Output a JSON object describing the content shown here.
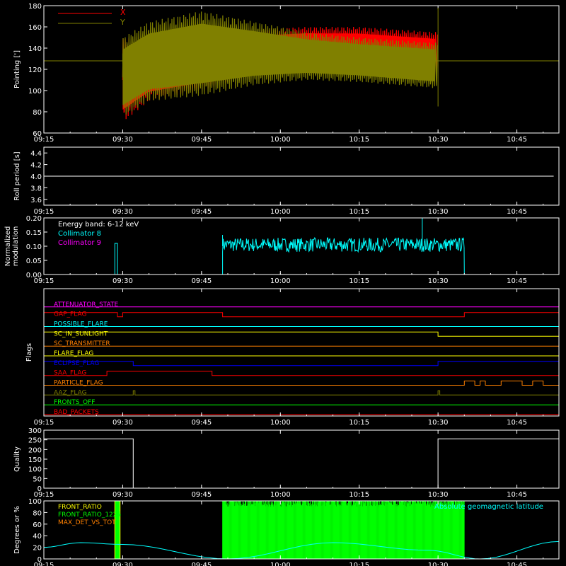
{
  "time_ticks": [
    "09:15",
    "09:30",
    "09:45",
    "10:00",
    "10:15",
    "10:30",
    "10:45"
  ],
  "colors": {
    "background": "#000000",
    "axes": "#ffffff",
    "x": "#ff0000",
    "y": "#808000",
    "cyan": "#00ffff",
    "magenta": "#ff00ff",
    "orange": "#ff8000",
    "yellow": "#ffff00",
    "blue": "#0000ff",
    "green": "#00ff00",
    "olive": "#808000",
    "red": "#ff0000"
  },
  "chart_data": [
    {
      "type": "line",
      "ylabel": "Pointing [']",
      "ylim": [
        60,
        180
      ],
      "yticks": [
        60,
        80,
        100,
        120,
        140,
        160,
        180
      ],
      "xlim": [
        "09:15",
        "10:53"
      ],
      "series": [
        {
          "name": "X",
          "color": "#ff0000",
          "envelope": [
            [
              "09:30",
              70,
              150
            ],
            [
              "09:35",
              90,
              150
            ],
            [
              "09:45",
              100,
              150
            ],
            [
              "09:55",
              115,
              158
            ],
            [
              "10:05",
              120,
              160
            ],
            [
              "10:15",
              118,
              160
            ],
            [
              "10:30",
              112,
              155
            ]
          ]
        },
        {
          "name": "Y",
          "color": "#808000",
          "envelope": [
            [
              "09:30",
              75,
              150
            ],
            [
              "09:35",
              90,
              165
            ],
            [
              "09:45",
              95,
              175
            ],
            [
              "09:55",
              105,
              165
            ],
            [
              "10:05",
              110,
              155
            ],
            [
              "10:15",
              108,
              150
            ],
            [
              "10:30",
              102,
              145
            ]
          ]
        }
      ],
      "reference_line": 128
    },
    {
      "type": "line",
      "ylabel": "Roll period [s]",
      "ylim": [
        3.5,
        4.5
      ],
      "yticks": [
        "3.6",
        "3.8",
        "4.0",
        "4.2",
        "4.4"
      ],
      "series": [
        {
          "values": [
            [
              "09:15",
              4.0
            ],
            [
              "10:52",
              4.0
            ]
          ]
        }
      ]
    },
    {
      "type": "line",
      "ylabel": "Normalized\nmodulation",
      "ylim": [
        0,
        0.2
      ],
      "yticks": [
        "0.00",
        "0.05",
        "0.10",
        "0.15",
        "0.20"
      ],
      "annotation": "Energy band: 6-12 keV",
      "series": [
        {
          "name": "Collimator 8",
          "color": "#00ffff",
          "segments": [
            [
              "09:28:30",
              "09:29:00",
              0.11
            ],
            [
              "09:49",
              "10:35",
              0.11
            ]
          ],
          "noise_range": [
            0.08,
            0.13
          ],
          "spikes": [
            [
              "09:49",
              0.14
            ],
            [
              "10:27",
              0.2
            ]
          ]
        },
        {
          "name": "Collimator 9",
          "color": "#ff00ff",
          "values": [
            [
              "09:15",
              0.0
            ],
            [
              "10:53",
              0.0
            ]
          ]
        }
      ]
    },
    {
      "type": "flags",
      "ylabel": "Flags",
      "flags": [
        {
          "name": "ATTENUATOR_STATE",
          "color": "#ff00ff",
          "high": []
        },
        {
          "name": "GAP_FLAG",
          "color": "#ff0000",
          "high": [
            [
              "09:15",
              "09:29"
            ],
            [
              "09:30",
              "09:49"
            ],
            [
              "10:35",
              "10:53"
            ]
          ]
        },
        {
          "name": "POSSIBLE_FLARE",
          "color": "#00ffff",
          "high": []
        },
        {
          "name": "SC_IN_SUNLIGHT",
          "color": "#ffff00",
          "high": [
            [
              "09:15",
              "10:30"
            ]
          ]
        },
        {
          "name": "SC_TRANSMITTER",
          "color": "#ff8000",
          "high": []
        },
        {
          "name": "FLARE_FLAG",
          "color": "#ffff00",
          "high": []
        },
        {
          "name": "ECLIPSE_FLAG",
          "color": "#0000ff",
          "high": [
            [
              "09:15",
              "09:32"
            ],
            [
              "10:30",
              "10:53"
            ]
          ]
        },
        {
          "name": "SAA_FLAG",
          "color": "#ff0000",
          "high": [
            [
              "09:27",
              "09:47"
            ]
          ]
        },
        {
          "name": "PARTICLE_FLAG",
          "color": "#ff8000",
          "high": [
            [
              "10:35",
              "10:37"
            ],
            [
              "10:38",
              "10:39"
            ],
            [
              "10:42",
              "10:46"
            ],
            [
              "10:48",
              "10:50"
            ]
          ]
        },
        {
          "name": "AAZ_FLAG",
          "color": "#808000",
          "high": [
            [
              "09:32",
              "09:32:20"
            ],
            [
              "10:30",
              "10:30:20"
            ]
          ]
        },
        {
          "name": "FRONTS_OFF",
          "color": "#00ff00",
          "high": []
        },
        {
          "name": "BAD_PACKETS",
          "color": "#ff0000",
          "high": []
        }
      ]
    },
    {
      "type": "line",
      "ylabel": "Quality",
      "ylim": [
        0,
        300
      ],
      "yticks": [
        0,
        50,
        100,
        150,
        200,
        250,
        300
      ],
      "series": [
        {
          "values": [
            [
              "09:15",
              255
            ],
            [
              "09:32",
              255
            ],
            [
              "09:32",
              0
            ],
            [
              "10:30",
              0
            ],
            [
              "10:30",
              255
            ],
            [
              "10:53",
              255
            ]
          ]
        }
      ]
    },
    {
      "type": "line",
      "ylabel": "Degrees or %",
      "ylim": [
        0,
        100
      ],
      "yticks": [
        0,
        20,
        40,
        60,
        80,
        100
      ],
      "series": [
        {
          "name": "FRONT_RATIO",
          "color": "#ffff00",
          "values": [
            [
              "09:28:30",
              100
            ],
            [
              "09:29:30",
              100
            ]
          ]
        },
        {
          "name": "FRONT_RATIO_1225",
          "color": "#00ff00",
          "band": [
            [
              "09:49",
              "10:35",
              100
            ]
          ],
          "early_band": [
            [
              "09:28:30",
              "09:29:30",
              100
            ]
          ]
        },
        {
          "name": "MAX_DET_VS_TOT",
          "color": "#ff8000",
          "values": [
            [
              "09:15",
              0
            ],
            [
              "10:53",
              0
            ]
          ]
        },
        {
          "name": "Absolute geomagnetic latitude",
          "color": "#00ffff",
          "values": [
            [
              "09:15",
              20
            ],
            [
              "09:22",
              28
            ],
            [
              "09:30",
              25
            ],
            [
              "09:50",
              0
            ],
            [
              "10:10",
              28
            ],
            [
              "10:28",
              15
            ],
            [
              "10:38",
              0
            ],
            [
              "10:53",
              30
            ]
          ]
        }
      ]
    }
  ]
}
